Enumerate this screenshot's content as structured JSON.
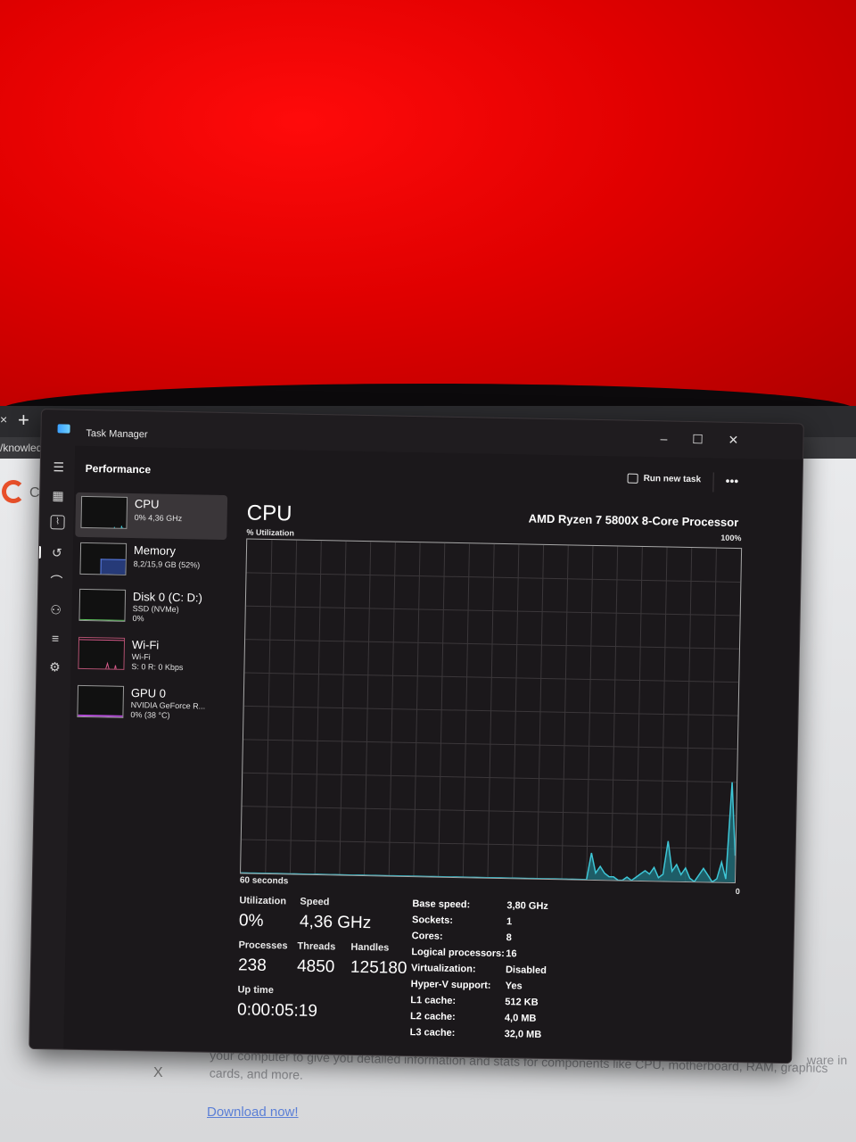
{
  "browser": {
    "tab_close": "×",
    "tab_add": "+",
    "url_fragment": "/knowledg",
    "logo_letter": "C",
    "body_text": "your computer to give you detailed information and stats for components like CPU, motherboard, RAM, graphics cards, and more.",
    "body_text_right": "ware in",
    "close_x": "X",
    "download_link": "Download now!"
  },
  "window": {
    "title": "Task Manager",
    "minimize": "–",
    "maximize": "☐",
    "close": "✕"
  },
  "header": {
    "title": "Performance",
    "run_new_task": "Run new task",
    "more": "•••"
  },
  "nav_icons": [
    "hamburger-icon",
    "processes-icon",
    "performance-icon",
    "app-history-icon",
    "startup-icon",
    "users-icon",
    "details-icon",
    "services-icon"
  ],
  "devices": [
    {
      "name": "CPU",
      "sub1": "0% 4,36 GHz",
      "sub2": ""
    },
    {
      "name": "Memory",
      "sub1": "8,2/15,9 GB (52%)",
      "sub2": ""
    },
    {
      "name": "Disk 0 (C: D:)",
      "sub1": "SSD (NVMe)",
      "sub2": "0%"
    },
    {
      "name": "Wi-Fi",
      "sub1": "Wi-Fi",
      "sub2": "S: 0 R: 0 Kbps"
    },
    {
      "name": "GPU 0",
      "sub1": "NVIDIA GeForce R...",
      "sub2": "0% (38 °C)"
    }
  ],
  "main": {
    "title": "CPU",
    "processor": "AMD Ryzen 7 5800X 8-Core Processor",
    "util_label": "% Utilization",
    "max_label": "100%",
    "time_label": "60 seconds",
    "min_label": "0"
  },
  "cpu_history": [
    0,
    0,
    0,
    0,
    0,
    0,
    0,
    0,
    0,
    0,
    0,
    0,
    0,
    0,
    0,
    0,
    0,
    0,
    0,
    0,
    0,
    0,
    0,
    0,
    0,
    0,
    0,
    0,
    0,
    0,
    0,
    0,
    0,
    0,
    0,
    0,
    0,
    0,
    0,
    0,
    0,
    0,
    0,
    0,
    0,
    0,
    0,
    0,
    0,
    0,
    0,
    0,
    0,
    0,
    0,
    0,
    0,
    0,
    0,
    0,
    0,
    0,
    0,
    0,
    0,
    0,
    0,
    0,
    0,
    0,
    0,
    0,
    0,
    0,
    0,
    0,
    0,
    0,
    8,
    2,
    4,
    2,
    1,
    1,
    0,
    0,
    1,
    0,
    1,
    2,
    3,
    2,
    4,
    1,
    2,
    12,
    3,
    5,
    2,
    4,
    1,
    0,
    2,
    4,
    2,
    0,
    1,
    6,
    1,
    30,
    8
  ],
  "stats": {
    "utilization_label": "Utilization",
    "utilization": "0%",
    "speed_label": "Speed",
    "speed": "4,36 GHz",
    "processes_label": "Processes",
    "processes": "238",
    "threads_label": "Threads",
    "threads": "4850",
    "handles_label": "Handles",
    "handles": "125180",
    "uptime_label": "Up time",
    "uptime": "0:00:05:19"
  },
  "specs": [
    {
      "key": "Base speed:",
      "value": "3,80 GHz"
    },
    {
      "key": "Sockets:",
      "value": "1"
    },
    {
      "key": "Cores:",
      "value": "8"
    },
    {
      "key": "Logical processors:",
      "value": "16"
    },
    {
      "key": "Virtualization:",
      "value": "Disabled"
    },
    {
      "key": "Hyper-V support:",
      "value": "Yes"
    },
    {
      "key": "L1 cache:",
      "value": "512 KB"
    },
    {
      "key": "L2 cache:",
      "value": "4,0 MB"
    },
    {
      "key": "L3 cache:",
      "value": "32,0 MB"
    }
  ],
  "colors": {
    "cpu_line": "#3ec6d6",
    "cpu_fill": "#1f6f7a",
    "memory_line": "#5a7ee6",
    "wifi_line": "#d65a8a",
    "gpu_line": "#b24bd6"
  }
}
